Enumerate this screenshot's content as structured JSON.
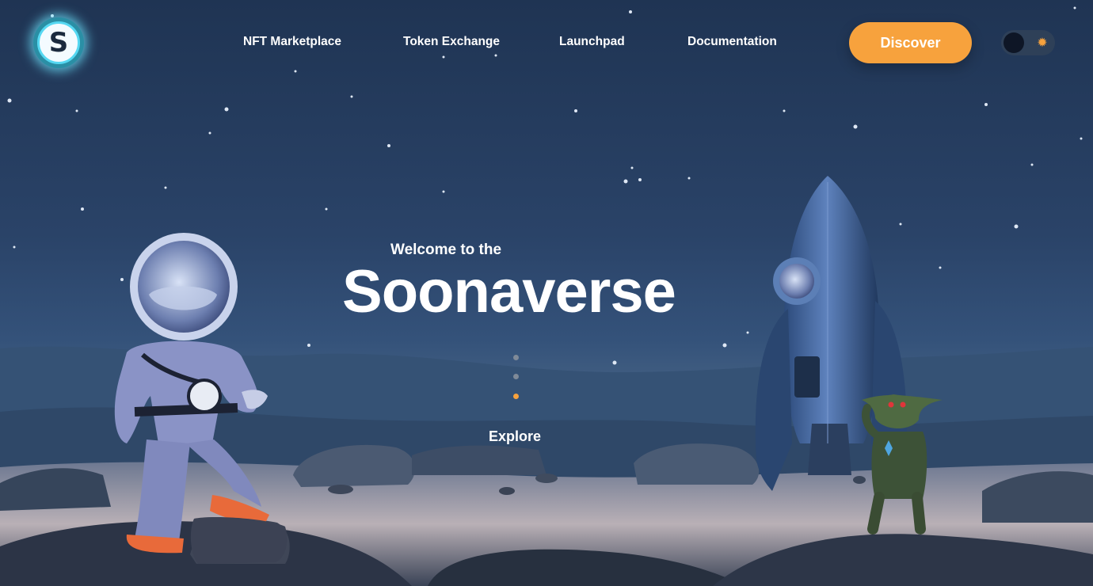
{
  "header": {
    "logo_letter": "S",
    "nav": [
      {
        "label": "NFT Marketplace"
      },
      {
        "label": "Token Exchange"
      },
      {
        "label": "Launchpad"
      },
      {
        "label": "Documentation"
      }
    ],
    "discover_label": "Discover",
    "theme_toggle": {
      "state": "dark",
      "icon": "sun-icon"
    }
  },
  "hero": {
    "welcome": "Welcome to the",
    "title": "Soonaverse",
    "slides": {
      "count": 3,
      "active": 3
    },
    "explore_label": "Explore"
  },
  "colors": {
    "accent": "#f7a23d",
    "sky_top": "#1f3453",
    "logo_glow": "#6ee6ff"
  }
}
